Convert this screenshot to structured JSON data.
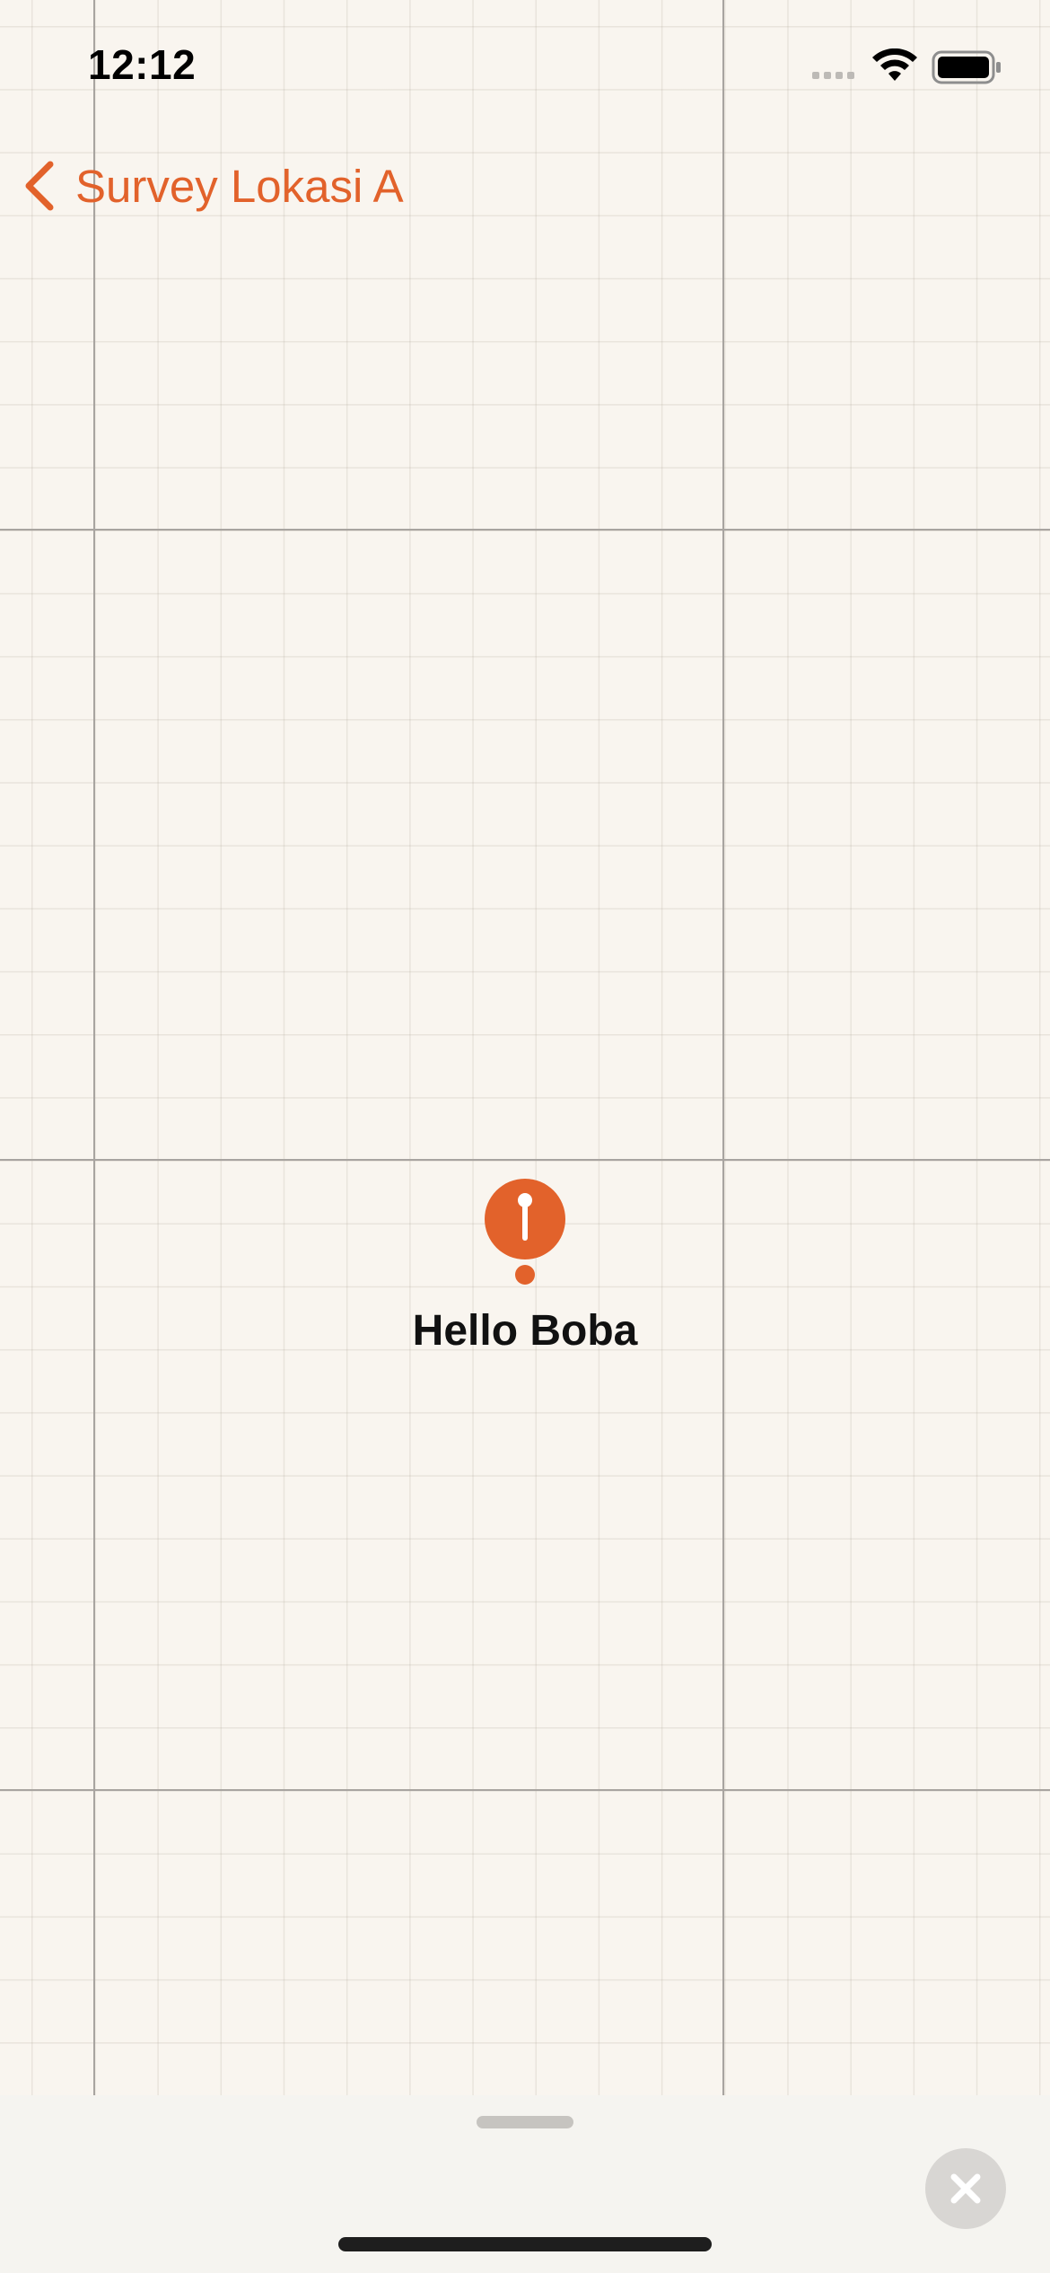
{
  "status_bar": {
    "time": "12:12"
  },
  "nav": {
    "back_label": "Survey Lokasi A",
    "back_icon": "chevron-left-icon"
  },
  "map": {
    "pin": {
      "label": "Hello Boba",
      "icon": "pin-icon",
      "color": "#e2622b"
    }
  },
  "sheet": {
    "close_icon": "close-icon"
  },
  "colors": {
    "accent": "#e2622b",
    "background": "#f9f5ef",
    "sheet": "#f5f4f0"
  }
}
